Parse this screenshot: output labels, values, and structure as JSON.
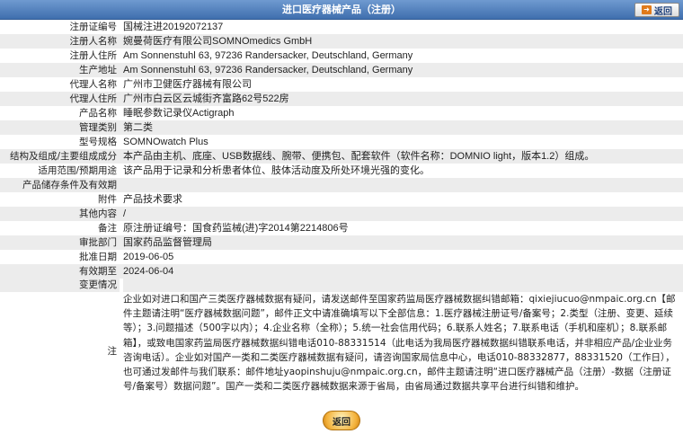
{
  "header": {
    "title": "进口医疗器械产品（注册）",
    "back_label": "返回"
  },
  "rows": [
    {
      "label": "注册证编号",
      "value": "国械注进20192072137"
    },
    {
      "label": "注册人名称",
      "value": "婉曼荷医疗有限公司SOMNOmedics GmbH"
    },
    {
      "label": "注册人住所",
      "value": "Am Sonnenstuhl 63, 97236 Randersacker, Deutschland, Germany"
    },
    {
      "label": "生产地址",
      "value": "Am Sonnenstuhl 63, 97236 Randersacker, Deutschland, Germany"
    },
    {
      "label": "代理人名称",
      "value": "广州市卫健医疗器械有限公司"
    },
    {
      "label": "代理人住所",
      "value": "广州市白云区云城街齐富路62号522房"
    },
    {
      "label": "产品名称",
      "value": "睡眠参数记录仪Actigraph"
    },
    {
      "label": "管理类别",
      "value": "第二类"
    },
    {
      "label": "型号规格",
      "value": "SOMNOwatch Plus"
    },
    {
      "label": "结构及组成/主要组成成分",
      "value": "本产品由主机、底座、USB数据线、腕带、便携包、配套软件（软件名称：DOMNIO light，版本1.2）组成。"
    },
    {
      "label": "适用范围/预期用途",
      "value": "该产品用于记录和分析患者体位、肢体活动度及所处环境光强的变化。"
    },
    {
      "label": "产品储存条件及有效期",
      "value": ""
    },
    {
      "label": "附件",
      "value": "产品技术要求"
    },
    {
      "label": "其他内容",
      "value": "/"
    },
    {
      "label": "备注",
      "value": "原注册证编号：国食药监械(进)字2014第2214806号"
    },
    {
      "label": "审批部门",
      "value": "国家药品监督管理局"
    },
    {
      "label": "批准日期",
      "value": "2019-06-05"
    },
    {
      "label": "有效期至",
      "value": "2024-06-04"
    }
  ],
  "change_label": "变更情况",
  "note_label": "注",
  "note_text": "企业如对进口和国产三类医疗器械数据有疑问，请发送邮件至国家药监局医疗器械数据纠错邮箱：qixiejiucuo@nmpaic.org.cn【邮件主题请注明“医疗器械数据问题”，邮件正文中请准确填写以下全部信息：1.医疗器械注册证号/备案号；2.类型（注册、变更、延续等）；3.问题描述（500字以内）；4.企业名称（全称）；5.统一社会信用代码；6.联系人姓名；7.联系电话（手机和座机）；8.联系邮箱】，或致电国家药监局医疗器械数据纠错电话010-88331514（此电话为我局医疗器械数据纠错联系电话，并非相应产品/企业业务咨询电话）。企业如对国产一类和二类医疗器械数据有疑问，请咨询国家局信息中心，电话010-88332877，88331520（工作日），也可通过发邮件与我们联系：邮件地址yaopinshuju@nmpaic.org.cn，邮件主题请注明“进口医疗器械产品（注册）-数据（注册证号/备案号）数据问题”。国产一类和二类医疗器械数据来源于省局，由省局通过数据共享平台进行纠错和维护。",
  "bottom_back_label": "返回",
  "colors": {
    "header_top": "#6f9ad0",
    "header_bottom": "#3f6fae",
    "row_alt": "#ececec",
    "accent": "#e07a1a"
  }
}
